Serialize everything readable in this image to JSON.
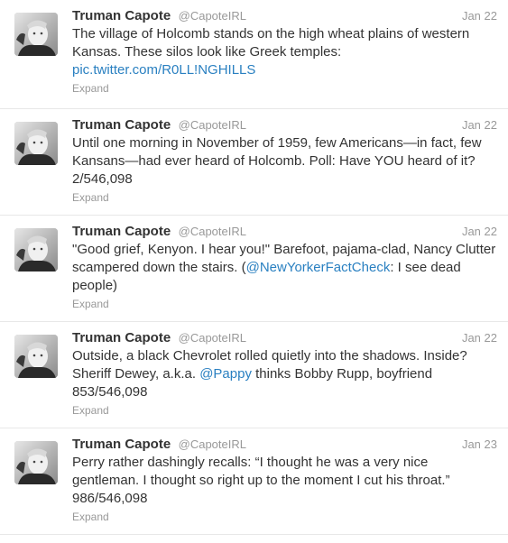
{
  "tweets": [
    {
      "name": "Truman Capote",
      "handle": "@CapoteIRL",
      "date": "Jan 22",
      "text_parts": [
        "The village of Holcomb stands on the high wheat plains of western Kansas. These silos look like Greek temples: "
      ],
      "link": "pic.twitter.com/R0LL!NGHILLS",
      "text_after": "",
      "expand": "Expand"
    },
    {
      "name": "Truman Capote",
      "handle": "@CapoteIRL",
      "date": "Jan 22",
      "text_parts": [
        "Until one morning in November of 1959, few Americans—in fact, few Kansans—had ever heard of Holcomb. Poll: Have YOU heard of it? 2/546,098"
      ],
      "link": "",
      "text_after": "",
      "expand": "Expand"
    },
    {
      "name": "Truman Capote",
      "handle": "@CapoteIRL",
      "date": "Jan 22",
      "text_parts": [
        "\"Good grief, Kenyon. I hear you!\" Barefoot, pajama-clad, Nancy Clutter scampered down the stairs. ("
      ],
      "link": "@NewYorkerFactCheck",
      "text_after": ": I see dead people)",
      "expand": "Expand"
    },
    {
      "name": "Truman Capote",
      "handle": "@CapoteIRL",
      "date": "Jan 22",
      "text_parts": [
        "Outside, a black Chevrolet rolled quietly into the shadows. Inside? Sheriff Dewey, a.k.a. "
      ],
      "link": "@Pappy",
      "text_after": " thinks Bobby Rupp, boyfriend 853/546,098",
      "expand": "Expand"
    },
    {
      "name": "Truman Capote",
      "handle": "@CapoteIRL",
      "date": "Jan 23",
      "text_parts": [
        "Perry rather dashingly recalls: “I thought he was a very nice gentleman. I thought so right up to the moment I cut his throat.” 986/546,098"
      ],
      "link": "",
      "text_after": "",
      "expand": "Expand"
    }
  ]
}
